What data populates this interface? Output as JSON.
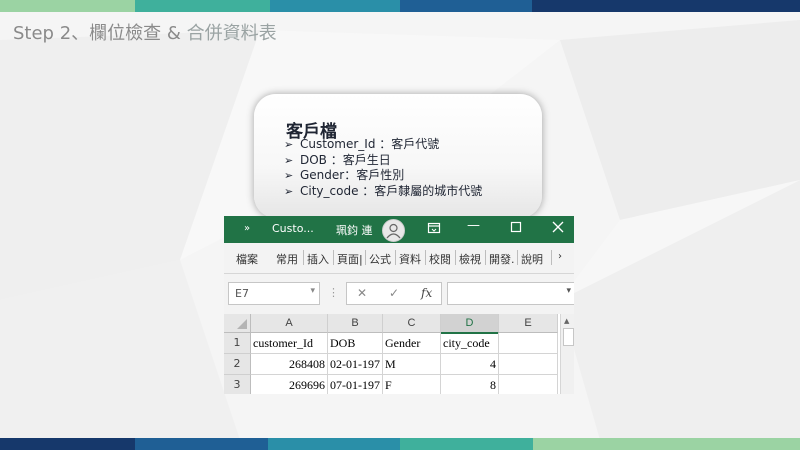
{
  "slide": {
    "title_part1": "Step 2、欄位檢查 & ",
    "title_part2": "合併資料表",
    "stripe_colors_top": [
      "#9bd3a3",
      "#3fb09c",
      "#2a8fa8",
      "#1f5f95",
      "#16386b"
    ],
    "stripe_colors_bottom": [
      "#16386b",
      "#1f5f95",
      "#2a8fa8",
      "#3fb09c",
      "#9bd3a3"
    ]
  },
  "card": {
    "title": "客戶檔",
    "bullet_glyph": "➢",
    "items": [
      "Customer_Id ：客戶代號",
      "DOB ：客戶生日",
      "Gender：客戶性別",
      "City_code ：客戶隸屬的城市代號"
    ]
  },
  "excel": {
    "accent": "#217346",
    "window_title": "Custo...",
    "user_name": "珮鈞 連",
    "ribbon_tabs": [
      "檔案",
      "常用",
      "插入",
      "頁面|",
      "公式",
      "資料",
      "校閱",
      "檢視",
      "開發.",
      "說明"
    ],
    "name_box": "E7",
    "fx_label": "fx",
    "columns": [
      "A",
      "B",
      "C",
      "D",
      "E"
    ],
    "selected_column": "D",
    "rows": [
      {
        "num": "1",
        "cells": [
          "customer_Id",
          "DOB",
          "Gender",
          "city_code",
          ""
        ]
      },
      {
        "num": "2",
        "cells": [
          "268408",
          "02-01-197",
          "M",
          "4",
          ""
        ]
      },
      {
        "num": "3",
        "cells": [
          "269696",
          "07-01-197",
          "F",
          "8",
          ""
        ]
      }
    ]
  }
}
